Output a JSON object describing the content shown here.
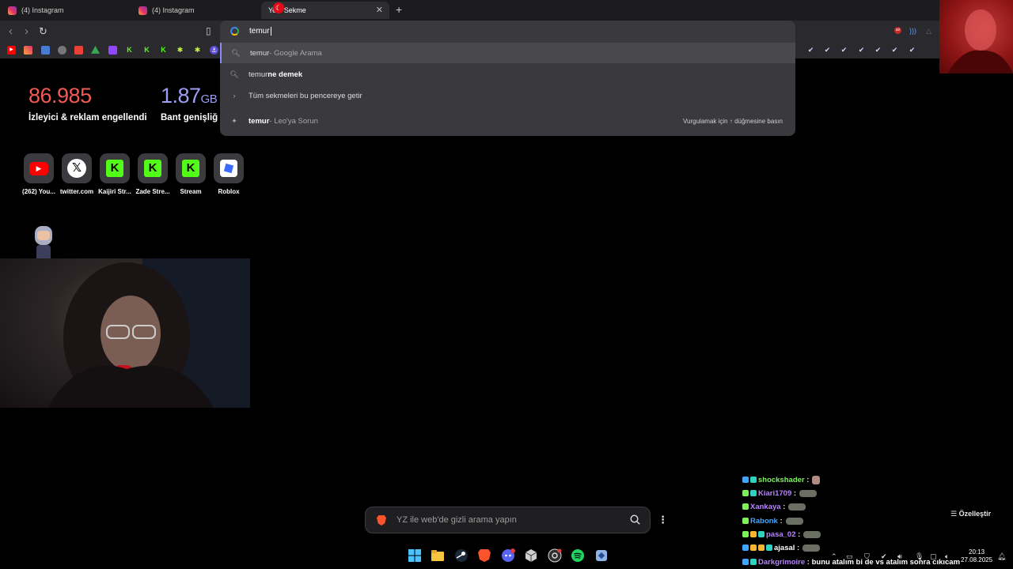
{
  "tabs": [
    {
      "label": "(4) Instagram"
    },
    {
      "label": "(4) Instagram"
    },
    {
      "label": "Yeni Sekme"
    }
  ],
  "omnibox": {
    "value": "temur"
  },
  "suggestions": [
    {
      "query": "temur",
      "suffix": " - Google Arama"
    },
    {
      "query": "temur",
      "bold": " ne demek"
    },
    {
      "label": "Tüm sekmeleri bu pencereye getir"
    },
    {
      "query": "temur",
      "suffix": "  - Leo'ya Sorun",
      "hint": "Vurgulamak için ↑ düğmesine basın"
    }
  ],
  "stats": {
    "trackers_value": "86.985",
    "trackers_label": "İzleyici & reklam engellendi",
    "bandwidth_value": "1.87",
    "bandwidth_unit": "GB",
    "bandwidth_label": "Bant genişliğ"
  },
  "shortcuts": [
    {
      "label": "(262) You...",
      "icon": "youtube-icon"
    },
    {
      "label": "twitter.com",
      "icon": "x-icon"
    },
    {
      "label": "Kaijiri Str...",
      "icon": "kick-icon"
    },
    {
      "label": "Zade Stre...",
      "icon": "kick-icon"
    },
    {
      "label": "Stream",
      "icon": "kick-icon"
    },
    {
      "label": "Roblox",
      "icon": "roblox-icon"
    }
  ],
  "search": {
    "placeholder": "YZ ile web'de gizli arama yapın"
  },
  "customize_label": "Özelleştir",
  "chat": [
    {
      "user": "shockshader",
      "color": "#7cf25a",
      "msg": ""
    },
    {
      "user": "Kiari1709",
      "color": "#b784ff",
      "msg": ""
    },
    {
      "user": "Xankaya",
      "color": "#b784ff",
      "msg": ""
    },
    {
      "user": "Rabonk",
      "color": "#3ea6ff",
      "msg": ""
    },
    {
      "user": "pasa_02",
      "color": "#b784ff",
      "msg": ""
    },
    {
      "user": "ajasal",
      "color": "#ffffff",
      "msg": ""
    },
    {
      "user": "Darkgrimoire",
      "color": "#b784ff",
      "msg": "bunu atalım bi de vs atalım sonra cıkıcam"
    }
  ],
  "clock": {
    "time": "20:13",
    "date": "27.08.2025"
  },
  "colors": {
    "accent": "#8b8bf5",
    "trackers": "#f25a52",
    "bandwidth": "#9e9ef5",
    "kick": "#53fc18"
  }
}
